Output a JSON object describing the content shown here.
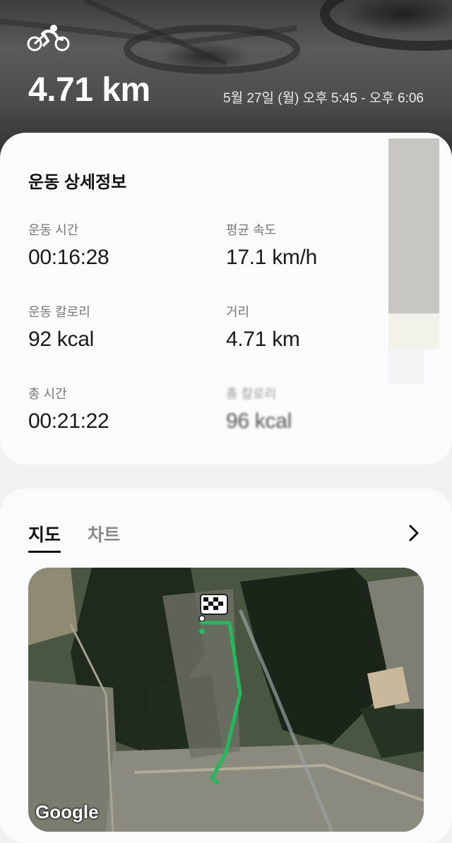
{
  "workout": {
    "icon": "cycling-icon",
    "distance": "4.71 km",
    "datetime": "5월 27일 (월) 오후 5:45 - 오후 6:06"
  },
  "details": {
    "title": "운동 상세정보",
    "stats": [
      {
        "label": "운동 시간",
        "value": "00:16:28"
      },
      {
        "label": "평균 속도",
        "value": "17.1 km/h"
      },
      {
        "label": "운동 칼로리",
        "value": "92 kcal"
      },
      {
        "label": "거리",
        "value": "4.71 km"
      },
      {
        "label": "총 시간",
        "value": "00:21:22"
      },
      {
        "label": "총 칼로리",
        "value": "96 kcal"
      }
    ]
  },
  "map_section": {
    "tabs": [
      {
        "label": "지도",
        "active": true
      },
      {
        "label": "차트",
        "active": false
      }
    ],
    "more_icon": "chevron-right-icon",
    "map_attribution": "Google",
    "route_color": "#1fba5a",
    "finish_icon": "checkered-flag-icon"
  }
}
